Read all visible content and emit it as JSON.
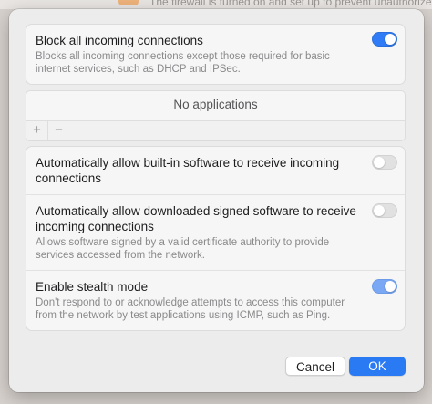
{
  "background": {
    "partial_text": "The firewall is turned on and set up to prevent unauthorized"
  },
  "block_card": {
    "title": "Block all incoming connections",
    "description": "Blocks all incoming connections except those required for basic internet services, such as DHCP and IPSec.",
    "enabled": true
  },
  "app_list": {
    "empty_text": "No applications",
    "add_symbol": "+",
    "remove_symbol": "−"
  },
  "options": {
    "builtin": {
      "title": "Automatically allow built-in software to receive incoming connections",
      "enabled": false
    },
    "signed": {
      "title": "Automatically allow downloaded signed software to receive incoming connections",
      "description": "Allows software signed by a valid certificate authority to provide services accessed from the network.",
      "enabled": false
    },
    "stealth": {
      "title": "Enable stealth mode",
      "description": "Don't respond to or acknowledge attempts to access this computer from the network by test applications using ICMP, such as Ping.",
      "enabled": true
    }
  },
  "buttons": {
    "cancel_label": "Cancel",
    "ok_label": "OK"
  },
  "colors": {
    "accent": "#2a7bf3",
    "sheet": "#ececec",
    "card": "#f6f6f6"
  },
  "icons": {
    "background_app": "firewall-app-icon"
  }
}
